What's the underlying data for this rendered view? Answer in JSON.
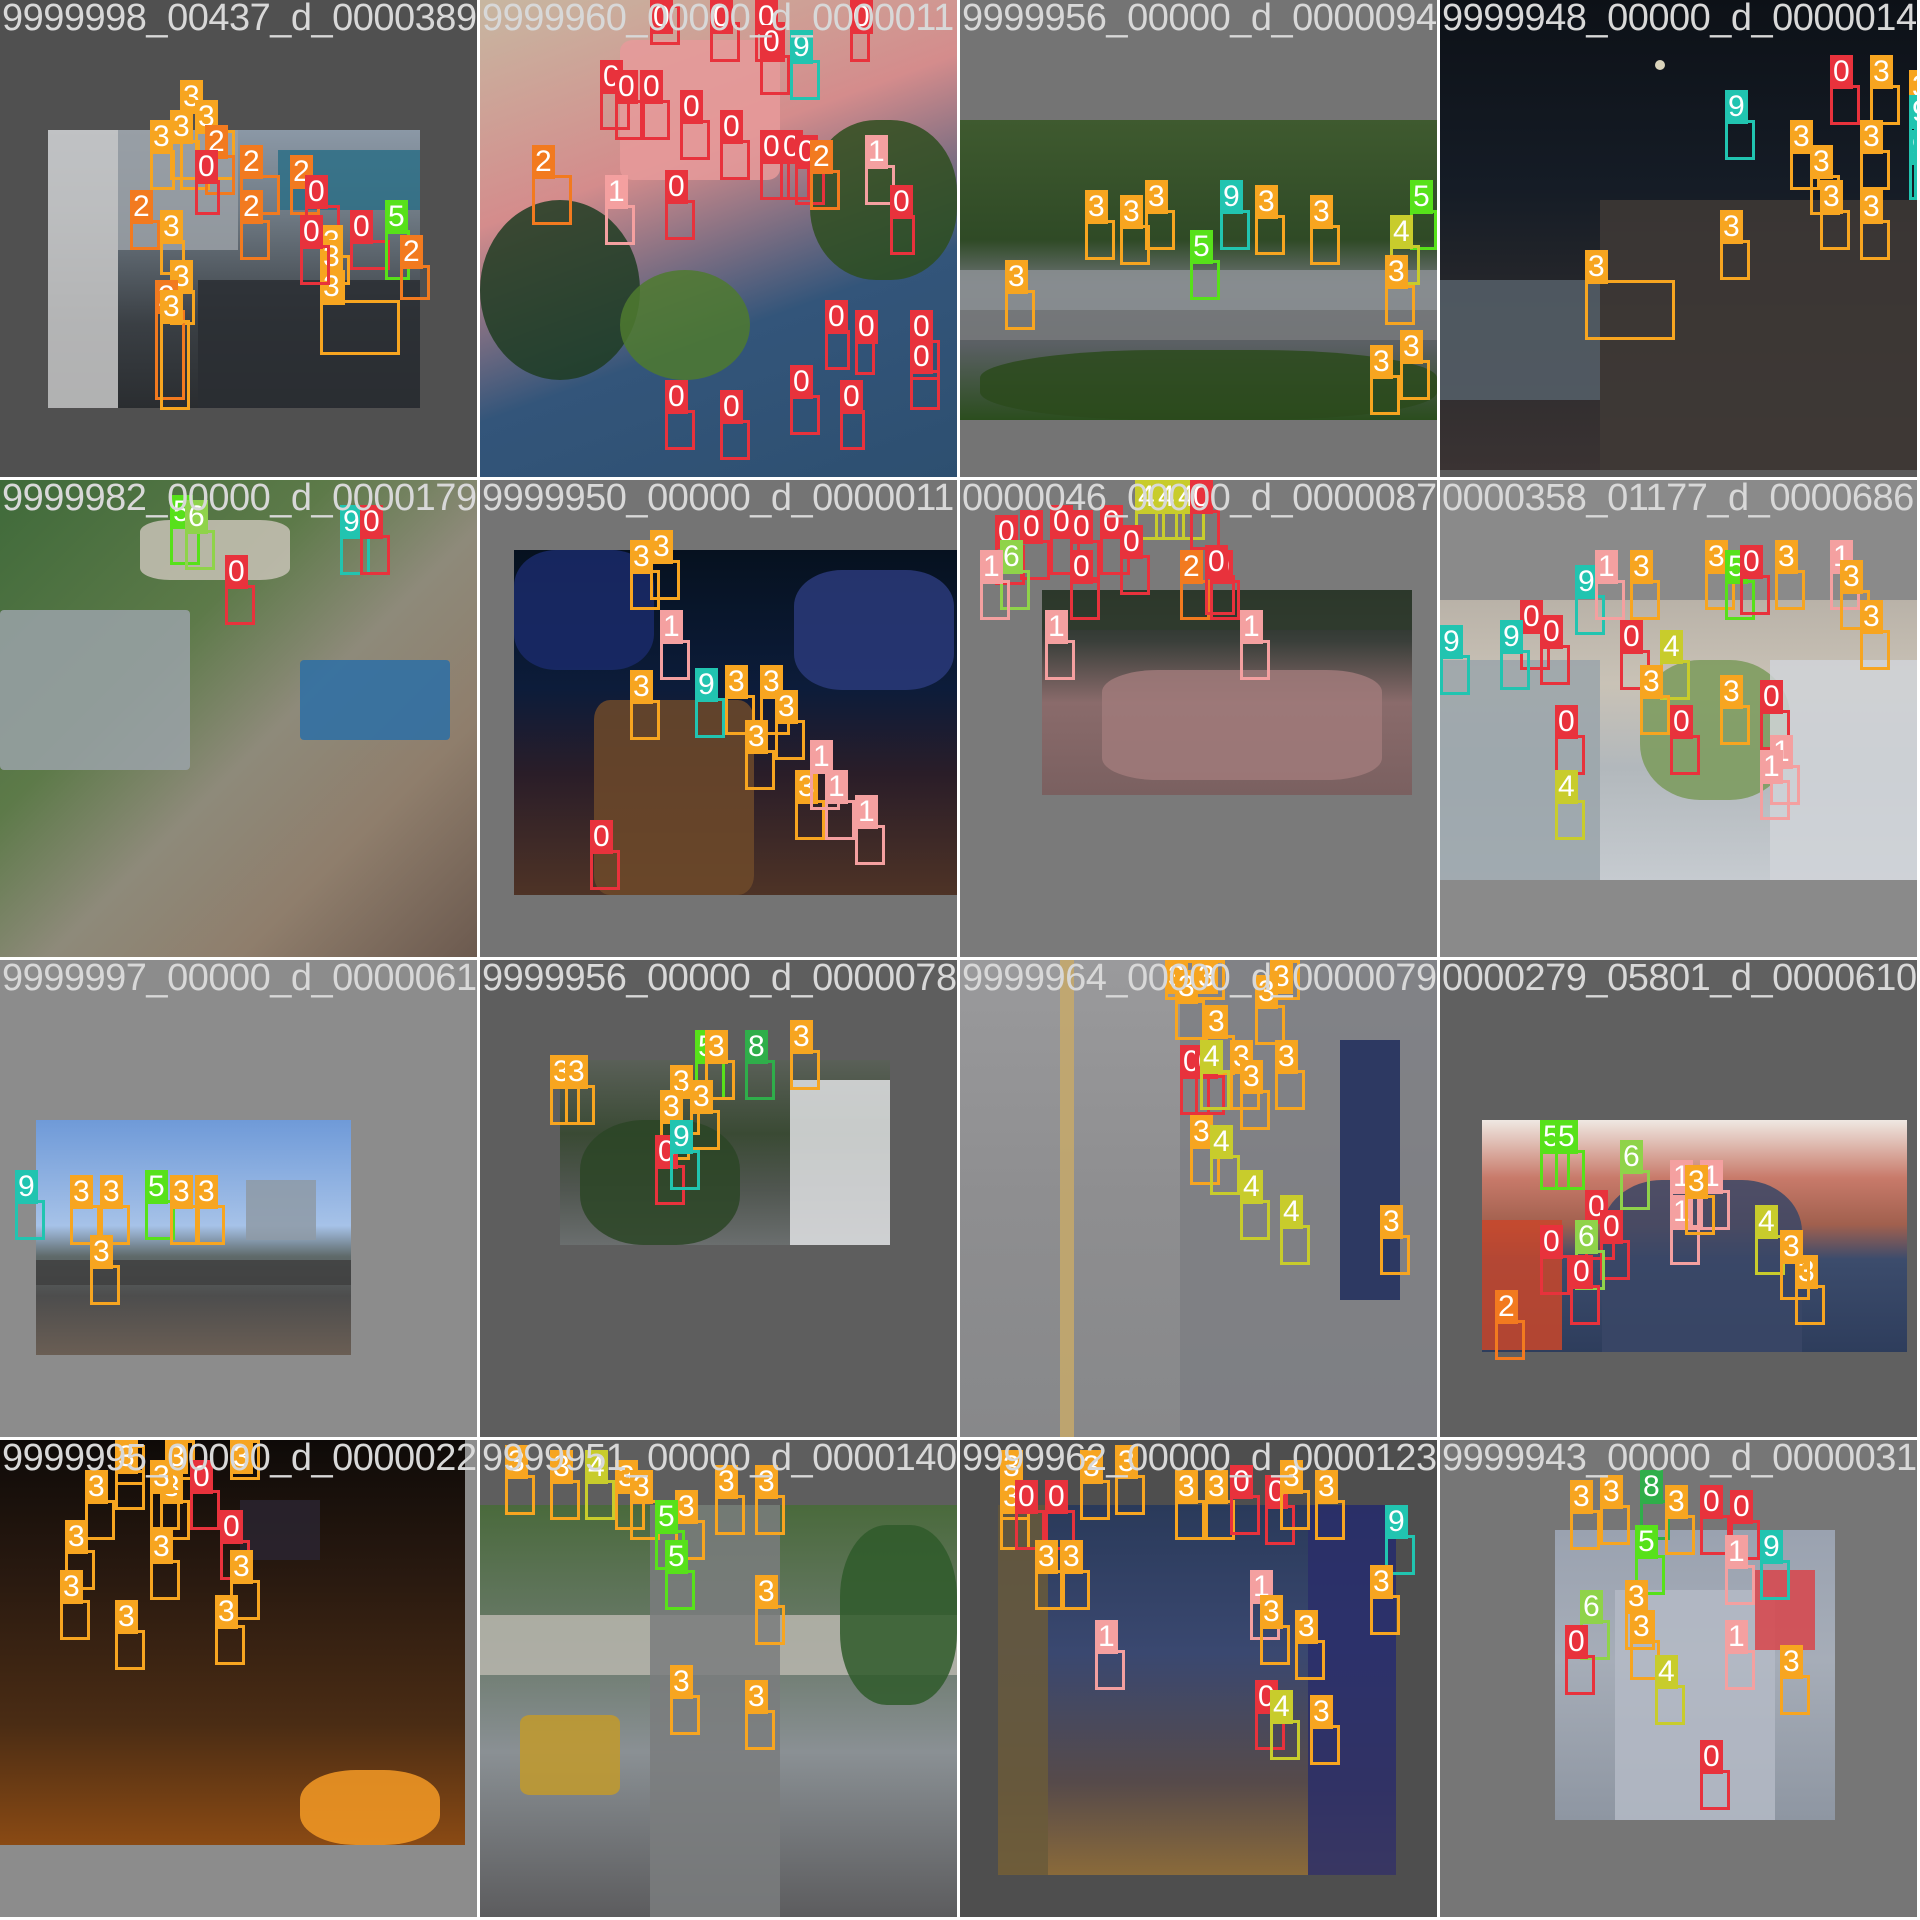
{
  "classes": {
    "0": "#e8323c",
    "1": "#f4a0a0",
    "2": "#f27a1f",
    "3": "#f7a520",
    "4": "#c8cc2c",
    "5": "#57e11a",
    "6": "#8fd34a",
    "8": "#2fae4a",
    "9": "#21c4b0"
  },
  "tiles": [
    {
      "filename": "9999998_00437_d_0000389.jpg",
      "labels": [
        "3",
        "3",
        "3",
        "3",
        "2",
        "2",
        "2",
        "0",
        "0",
        "2",
        "2",
        "3",
        "3",
        "3",
        "2",
        "0",
        "3",
        "3",
        "0",
        "5",
        "2",
        "3"
      ]
    },
    {
      "filename": "9999960_00000_d_0000011.jpg",
      "labels": [
        "0",
        "0",
        "0",
        "0",
        "9",
        "0",
        "0",
        "0",
        "0",
        "0",
        "0",
        "0",
        "0",
        "0",
        "2",
        "2",
        "1",
        "1",
        "0",
        "0",
        "0",
        "0",
        "0",
        "0",
        "0",
        "0",
        "0",
        "0"
      ]
    },
    {
      "filename": "9999956_00000_d_0000094.jpg",
      "labels": [
        "3",
        "3",
        "3",
        "9",
        "3",
        "3",
        "5",
        "5",
        "4",
        "3",
        "3",
        "3",
        "3"
      ]
    },
    {
      "filename": "9999948_00000_d_0000014.jpg",
      "labels": [
        "0",
        "3",
        "3",
        "9",
        "9",
        "9",
        "3",
        "3",
        "3",
        "3",
        "3",
        "3",
        "3"
      ]
    },
    {
      "filename": "9999982_00000_d_0000179.jpg",
      "labels": [
        "5",
        "6",
        "9",
        "0",
        "0"
      ]
    },
    {
      "filename": "9999950_00000_d_0000011.jpg",
      "labels": [
        "3",
        "3",
        "1",
        "3",
        "9",
        "3",
        "3",
        "3",
        "3",
        "3",
        "1",
        "1",
        "1",
        "0"
      ]
    },
    {
      "filename": "0000046_00000_d_0000087.jpg",
      "labels": [
        "4",
        "4",
        "4",
        "0",
        "0",
        "0",
        "0",
        "0",
        "0",
        "6",
        "0",
        "1",
        "2",
        "0",
        "0",
        "1",
        "0",
        "1"
      ]
    },
    {
      "filename": "0000358_01177_d_0000686.jpg",
      "labels": [
        "9",
        "1",
        "3",
        "3",
        "5",
        "0",
        "3",
        "1",
        "3",
        "3",
        "0",
        "9",
        "9",
        "0",
        "0",
        "4",
        "3",
        "3",
        "0",
        "0",
        "0",
        "1",
        "4",
        "1"
      ]
    },
    {
      "filename": "9999997_00000_d_0000061.jpg",
      "labels": [
        "9",
        "3",
        "3",
        "5",
        "3",
        "3",
        "3"
      ]
    },
    {
      "filename": "9999956_00000_d_0000078.jpg",
      "labels": [
        "3",
        "3",
        "5",
        "3",
        "8",
        "3",
        "3",
        "3",
        "3",
        "0",
        "9"
      ]
    },
    {
      "filename": "9999964_00000_d_0000079.jpg",
      "labels": [
        "3",
        "3",
        "3",
        "3",
        "3",
        "3",
        "0",
        "0",
        "4",
        "3",
        "3",
        "3",
        "3",
        "4",
        "4",
        "4",
        "3"
      ]
    },
    {
      "filename": "0000279_05801_d_0000610.jpg",
      "labels": [
        "5",
        "5",
        "6",
        "1",
        "1",
        "0",
        "1",
        "0",
        "4",
        "3",
        "0",
        "6",
        "2",
        "0",
        "3",
        "3"
      ]
    },
    {
      "filename": "9999995_00000_d_0000022.jpg",
      "labels": [
        "3",
        "3",
        "3",
        "3",
        "3",
        "3",
        "0",
        "3",
        "0",
        "3",
        "3",
        "3",
        "3",
        "3",
        "3"
      ]
    },
    {
      "filename": "9999951_00000_d_0000140.jpg",
      "labels": [
        "3",
        "3",
        "4",
        "3",
        "3",
        "3",
        "3",
        "3",
        "5",
        "5",
        "3",
        "3",
        "3"
      ]
    },
    {
      "filename": "9999962_00000_d_0000123.jpg",
      "labels": [
        "3",
        "3",
        "0",
        "0",
        "3",
        "3",
        "3",
        "3",
        "0",
        "0",
        "3",
        "3",
        "9",
        "3",
        "3",
        "1",
        "1",
        "3",
        "3",
        "0",
        "4",
        "3",
        "3"
      ]
    },
    {
      "filename": "9999943_00000_d_0000031.jpg",
      "labels": [
        "3",
        "3",
        "8",
        "0",
        "0",
        "3",
        "5",
        "1",
        "9",
        "6",
        "3",
        "3",
        "0",
        "1",
        "0",
        "4",
        "3"
      ]
    }
  ]
}
